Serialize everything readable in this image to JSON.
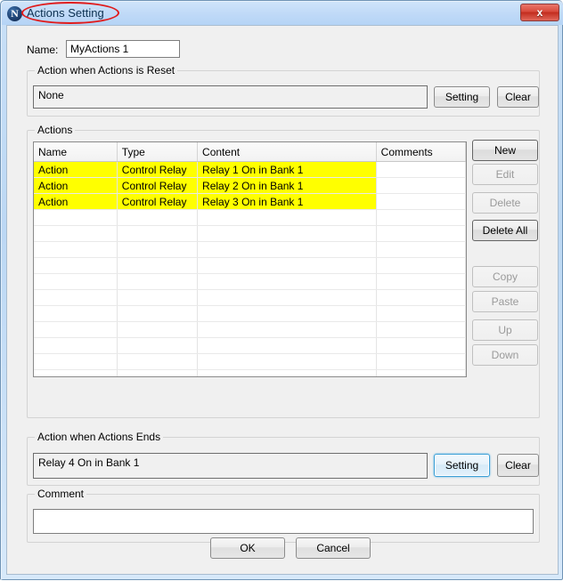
{
  "window": {
    "title": "Actions Setting",
    "app_icon_letter": "N",
    "close_label": "x"
  },
  "form": {
    "name_label": "Name:",
    "name_value": "MyActions 1",
    "name_placeholder": ""
  },
  "reset_group": {
    "title": "Action when Actions is Reset",
    "value": "None",
    "setting_label": "Setting",
    "clear_label": "Clear"
  },
  "actions_group": {
    "title": "Actions",
    "columns": [
      "Name",
      "Type",
      "Content",
      "Comments"
    ],
    "rows": [
      {
        "name": "Action",
        "type": "Control Relay",
        "content": "Relay 1 On in Bank 1",
        "comments": "",
        "highlight": true
      },
      {
        "name": "Action",
        "type": "Control Relay",
        "content": "Relay 2 On in Bank 1",
        "comments": "",
        "highlight": true
      },
      {
        "name": "Action",
        "type": "Control Relay",
        "content": "Relay 3 On in Bank 1",
        "comments": "",
        "highlight": true
      }
    ],
    "empty_row_count": 11,
    "highlight_color": "#ffff00",
    "buttons": [
      {
        "label": "New",
        "enabled": true
      },
      {
        "label": "Edit",
        "enabled": false
      },
      {
        "label": "Delete",
        "enabled": false
      },
      {
        "label": "Delete All",
        "enabled": true
      },
      {
        "label": "Copy",
        "enabled": false
      },
      {
        "label": "Paste",
        "enabled": false
      },
      {
        "label": "Up",
        "enabled": false
      },
      {
        "label": "Down",
        "enabled": false
      }
    ]
  },
  "ends_group": {
    "title": "Action when Actions Ends",
    "value": "Relay 4 On in Bank 1",
    "setting_label": "Setting",
    "clear_label": "Clear"
  },
  "comment_group": {
    "title": "Comment",
    "value": "",
    "placeholder": ""
  },
  "dialog_buttons": {
    "ok_label": "OK",
    "cancel_label": "Cancel"
  },
  "colors": {
    "titlebar": "#bcd8f4",
    "close_button": "#d84a3c",
    "client_background": "#f0f0f0",
    "highlight": "#ffff00",
    "focus_ring": "#3c9fd6"
  }
}
